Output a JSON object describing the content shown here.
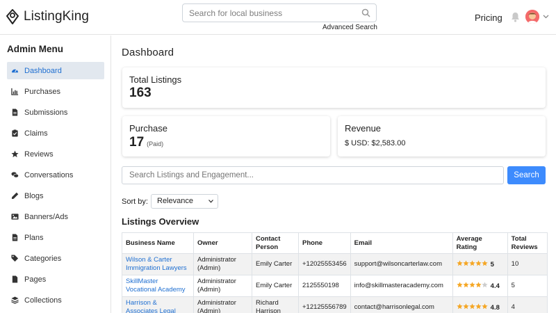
{
  "header": {
    "logo_text": "ListingKing",
    "search_placeholder": "Search for local business",
    "advanced_search": "Advanced Search",
    "pricing": "Pricing"
  },
  "sidebar": {
    "title": "Admin Menu",
    "items": [
      {
        "label": "Dashboard",
        "icon": "gauge-icon",
        "active": true
      },
      {
        "label": "Purchases",
        "icon": "chart-icon"
      },
      {
        "label": "Submissions",
        "icon": "file-icon"
      },
      {
        "label": "Claims",
        "icon": "clipboard-check-icon"
      },
      {
        "label": "Reviews",
        "icon": "star-icon"
      },
      {
        "label": "Conversations",
        "icon": "comments-icon"
      },
      {
        "label": "Blogs",
        "icon": "pencil-icon"
      },
      {
        "label": "Banners/Ads",
        "icon": "image-icon"
      },
      {
        "label": "Plans",
        "icon": "file-icon"
      },
      {
        "label": "Categories",
        "icon": "tags-icon"
      },
      {
        "label": "Pages",
        "icon": "file-icon"
      },
      {
        "label": "Collections",
        "icon": "layers-icon"
      }
    ]
  },
  "main": {
    "title": "Dashboard",
    "total_listings": {
      "label": "Total Listings",
      "value": "163"
    },
    "purchase": {
      "label": "Purchase",
      "value": "17",
      "sub": "(Paid)"
    },
    "revenue": {
      "label": "Revenue",
      "value": "$ USD: $2,583.00"
    },
    "search_placeholder": "Search Listings and Engagement...",
    "search_button": "Search",
    "sort_label": "Sort by:",
    "sort_value": "Relevance",
    "overview_title": "Listings Overview",
    "table": {
      "headers": [
        "Business Name",
        "Owner",
        "Contact Person",
        "Phone",
        "Email",
        "Average Rating",
        "Total Reviews"
      ],
      "rows": [
        {
          "business": "Wilson & Carter Immigration Lawyers",
          "owner": "Administrator (Admin)",
          "contact": "Emily Carter",
          "phone": "+12025553456",
          "email": "support@wilsoncarterlaw.com",
          "rating": "5",
          "stars": 5,
          "reviews": "10"
        },
        {
          "business": "SkillMaster Vocational Academy",
          "owner": "Administrator (Admin)",
          "contact": "Emily Carter",
          "phone": "2125550198",
          "email": "info@skillmasteracademy.com",
          "rating": "4.4",
          "stars": 4,
          "reviews": "5"
        },
        {
          "business": "Harrison & Associates Legal",
          "owner": "Administrator (Admin)",
          "contact": "Richard Harrison",
          "phone": "+12125556789",
          "email": "contact@harrisonlegal.com",
          "rating": "4.8",
          "stars": 5,
          "reviews": "4"
        }
      ]
    }
  },
  "colors": {
    "accent": "#1f6fd1",
    "button": "#3d8bfd",
    "star": "#f5a623",
    "star_empty": "#cccccc",
    "active_bg": "#e2e8ef"
  }
}
